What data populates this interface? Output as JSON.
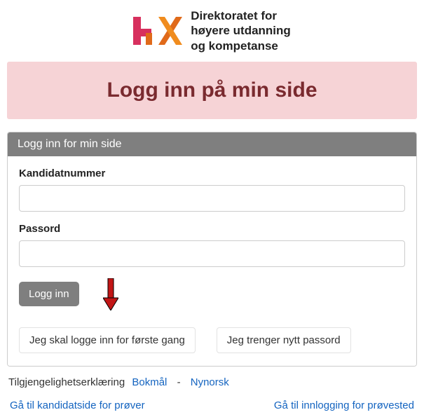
{
  "header": {
    "org_line1": "Direktoratet for",
    "org_line2": "høyere utdanning",
    "org_line3": "og kompetanse"
  },
  "banner": {
    "title": "Logg inn på min side"
  },
  "card": {
    "header": "Logg inn for min side",
    "candidate_label": "Kandidatnummer",
    "password_label": "Passord",
    "candidate_value": "",
    "password_value": "",
    "login_button": "Logg inn",
    "first_time_button": "Jeg skal logge inn for første gang",
    "new_password_button": "Jeg trenger nytt passord"
  },
  "footer": {
    "accessibility": "Tilgjengelighetserklæring",
    "lang_bokmal": "Bokmål",
    "lang_nynorsk": "Nynorsk",
    "link_candidate": "Gå til kandidatside for prøver",
    "link_testsite": "Gå til innlogging for prøvested"
  }
}
